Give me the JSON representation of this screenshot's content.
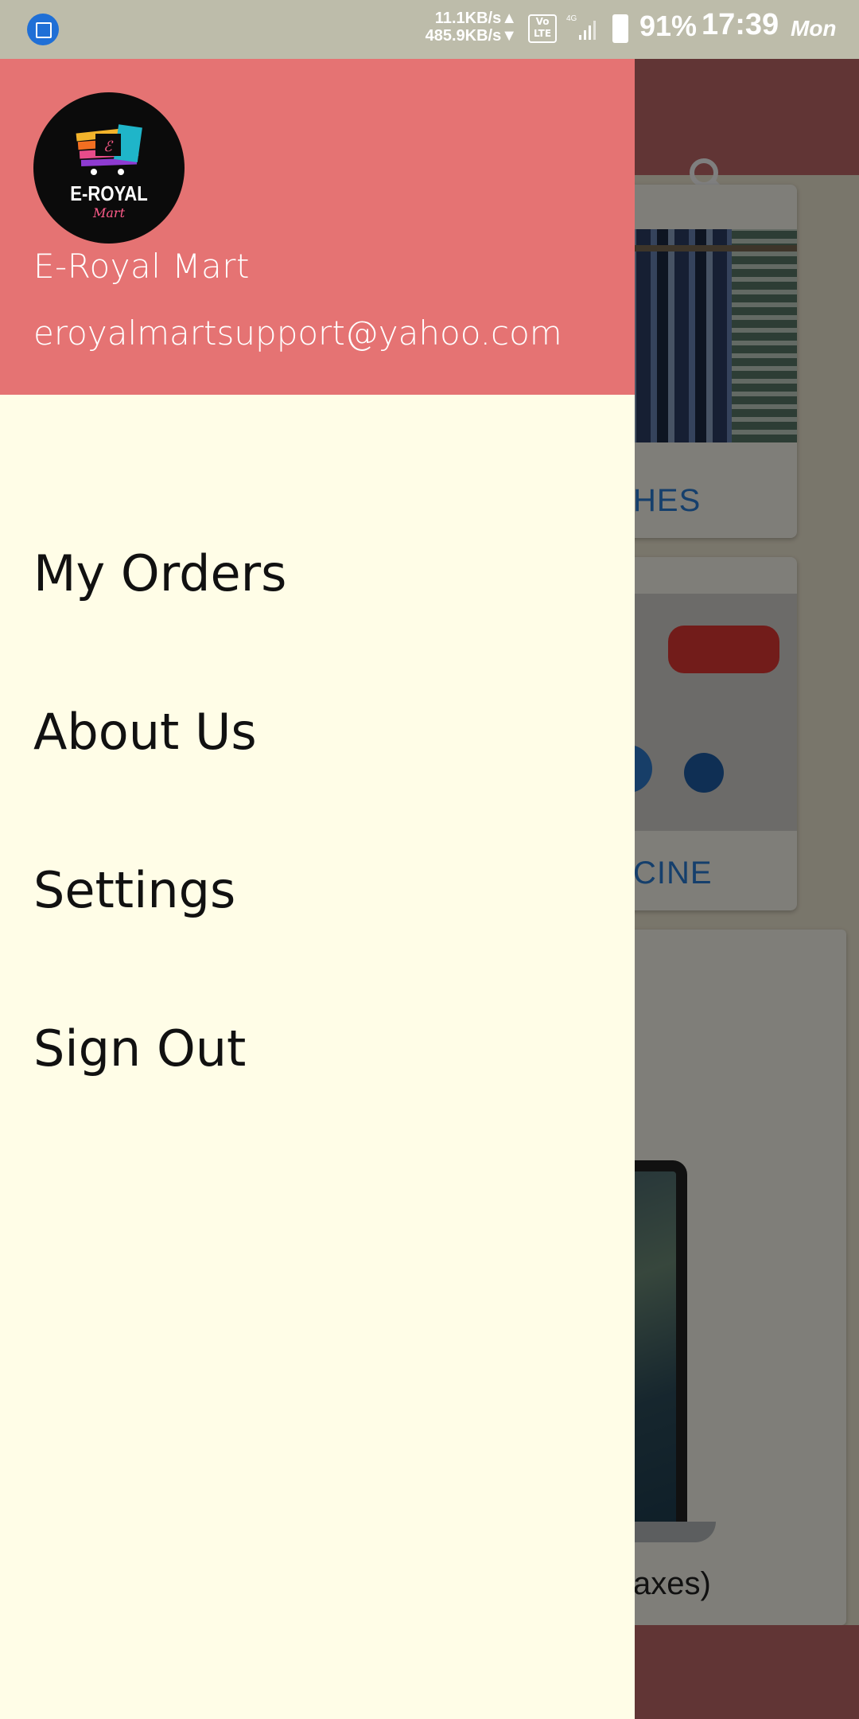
{
  "status_bar": {
    "net_up": "11.1KB/s▲",
    "net_down": "485.9KB/s▼",
    "volte": "Vo LTE",
    "network": "4G",
    "battery": "91%",
    "time": "17:39",
    "day": "Mon"
  },
  "drawer": {
    "header": {
      "logo_text": "E-ROYAL",
      "logo_sub": "Mart",
      "name": "E-Royal Mart",
      "email": "eroyalmartsupport@yahoo.com"
    },
    "menu": [
      {
        "label": "My Orders"
      },
      {
        "label": "About Us"
      },
      {
        "label": "Settings"
      },
      {
        "label": "Sign Out"
      }
    ]
  },
  "background": {
    "card_clothes_label": "HES",
    "card_medicine_label": "CINE",
    "promo_caption": "axes)"
  },
  "colors": {
    "header": "#e57373",
    "drawer": "#fffde7",
    "toolbar": "#c26a6a"
  }
}
